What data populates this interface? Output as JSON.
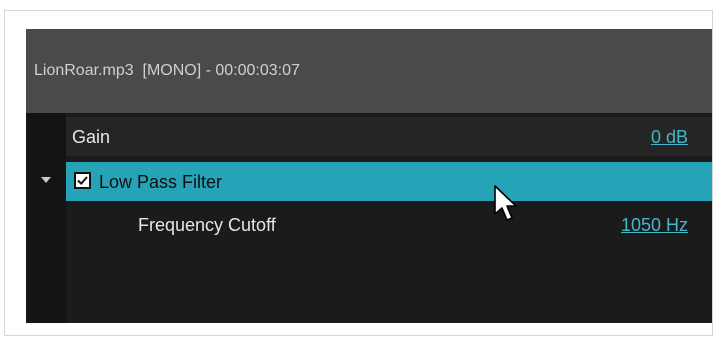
{
  "panel": {
    "title": "LionRoar.mp3  [MONO] - 00:00:03:07"
  },
  "rows": [
    {
      "label": "Gain",
      "value": "0 dB"
    },
    {
      "label": "Low Pass Filter",
      "checked": true,
      "expanded": true
    },
    {
      "label": "Frequency Cutoff",
      "value": "1050 Hz"
    }
  ],
  "colors": {
    "selection": "#25a3b7",
    "link": "#43b7cb",
    "panel_bg": "#1b1b1b",
    "header_bg": "#4a4a4a"
  },
  "icons": [
    "expand-arrow-icon",
    "checkmark-icon",
    "mouse-pointer-icon"
  ]
}
